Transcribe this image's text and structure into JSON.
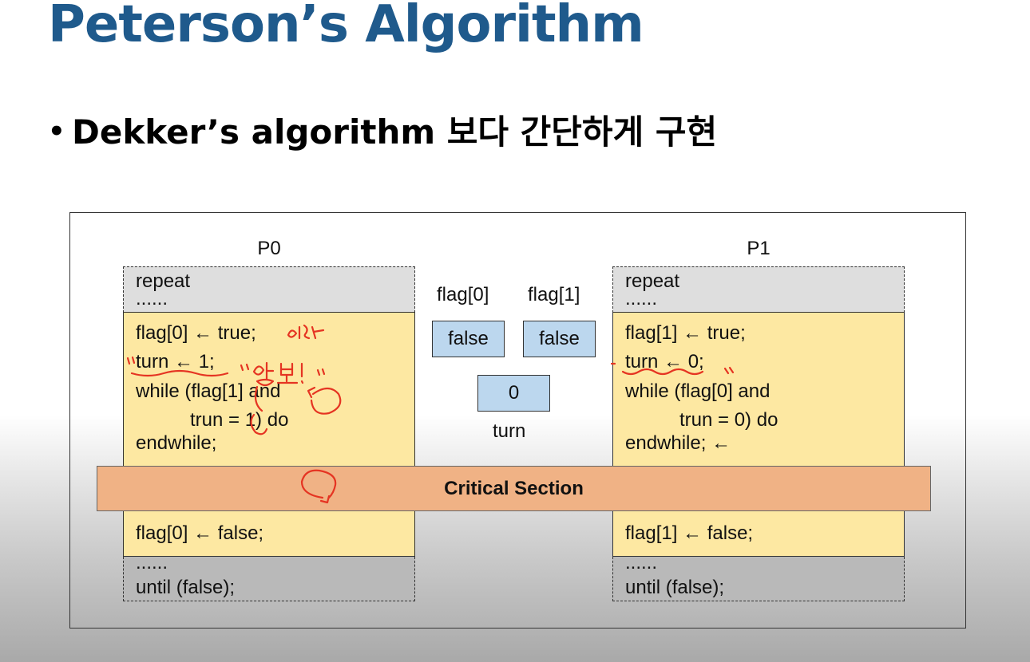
{
  "slide": {
    "title": "Peterson’s Algorithm",
    "bullet": "Dekker’s algorithm 보다 간단하게 구현"
  },
  "diagram": {
    "p0": {
      "label": "P0",
      "header_lines": [
        "repeat",
        "......"
      ],
      "entry_lines": [
        "flag[0] ← true;",
        "turn ← 1;",
        "while (flag[1] and",
        "trun = 1) do",
        "endwhile;"
      ],
      "exit_lines": [
        "flag[0] ← false;"
      ],
      "footer_lines": [
        "......",
        "until (false);"
      ]
    },
    "p1": {
      "label": "P1",
      "header_lines": [
        "repeat",
        "......"
      ],
      "entry_lines": [
        "flag[1] ← true;",
        "turn ← 0;",
        "while (flag[0] and",
        "trun = 0) do",
        "endwhile; ←"
      ],
      "exit_lines": [
        "flag[1] ← false;"
      ],
      "footer_lines": [
        "......",
        "until (false);"
      ]
    },
    "shared": {
      "flag0_label": "flag[0]",
      "flag1_label": "flag[1]",
      "flag0_value": "false",
      "flag1_value": "false",
      "turn_value": "0",
      "turn_label": "turn"
    },
    "critical_section": "Critical Section"
  },
  "annotations": {
    "ink_color": "#e53422"
  }
}
